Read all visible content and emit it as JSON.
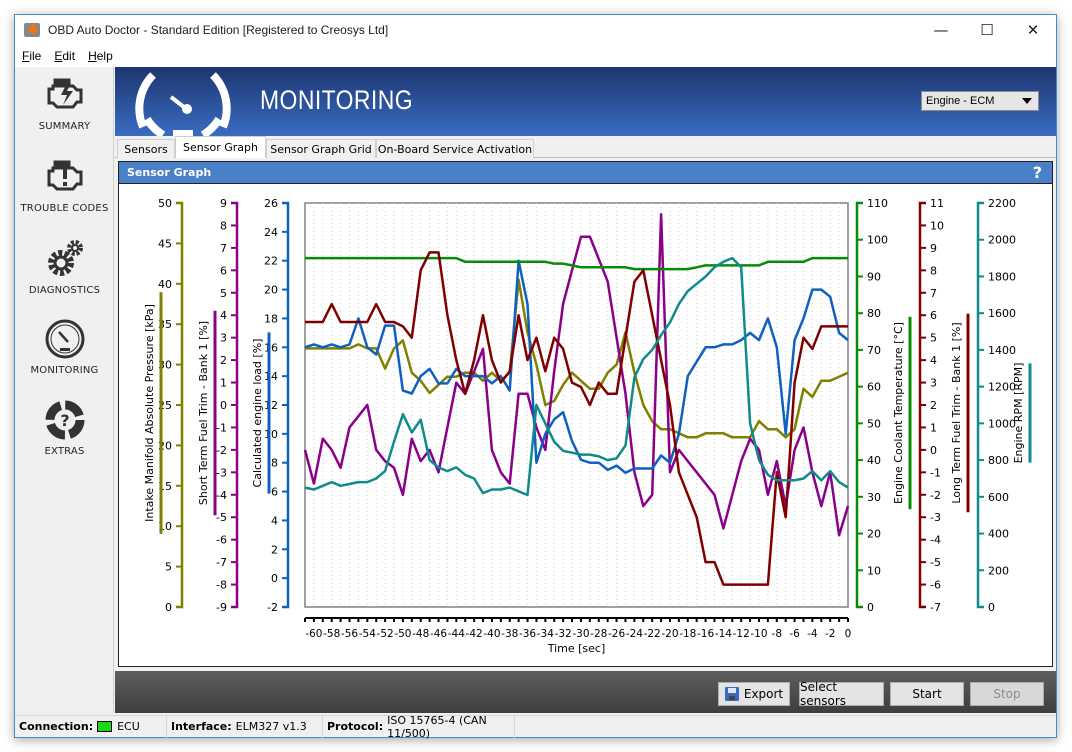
{
  "window": {
    "title": "OBD Auto Doctor - Standard Edition [Registered to Creosys Ltd]",
    "icon": "app-logo-icon",
    "controls": [
      "minimize",
      "maximize",
      "close"
    ],
    "control_glyphs": [
      "—",
      "☐",
      "✕"
    ]
  },
  "menu": [
    {
      "label": "File",
      "accel": "F",
      "rest": "ile"
    },
    {
      "label": "Edit",
      "accel": "E",
      "rest": "dit"
    },
    {
      "label": "Help",
      "accel": "H",
      "rest": "elp"
    }
  ],
  "sidebar": {
    "items": [
      {
        "label": "SUMMARY",
        "icon": "engine-check-icon"
      },
      {
        "label": "TROUBLE CODES",
        "icon": "engine-warning-icon"
      },
      {
        "label": "DIAGNOSTICS",
        "icon": "gears-icon"
      },
      {
        "label": "MONITORING",
        "icon": "gauge-icon",
        "active": true
      },
      {
        "label": "EXTRAS",
        "icon": "lifebuoy-help-icon"
      }
    ]
  },
  "header": {
    "title": "MONITORING",
    "ecu_select": {
      "value": "Engine - ECM"
    }
  },
  "tabs": [
    {
      "label": "Sensors",
      "active": false
    },
    {
      "label": "Sensor Graph",
      "active": true
    },
    {
      "label": "Sensor Graph Grid",
      "active": false
    },
    {
      "label": "On-Board Service Activation",
      "active": false
    }
  ],
  "panel": {
    "title": "Sensor Graph",
    "help": "?"
  },
  "buttons": {
    "export": "Export",
    "select_sensors": "Select sensors",
    "start": "Start",
    "stop": "Stop"
  },
  "status": {
    "connection_label": "Connection:",
    "connection_value": "ECU",
    "connection_color": "#18d818",
    "interface_label": "Interface:",
    "interface_value": "ELM327 v1.3",
    "protocol_label": "Protocol:",
    "protocol_value": "ISO 15765-4 (CAN 11/500)"
  },
  "chart_data": {
    "type": "line",
    "title": "Sensor Graph",
    "xlabel": "Time [sec]",
    "xlim": [
      -61,
      0
    ],
    "x_ticks": [
      -60,
      -58,
      -56,
      -54,
      -52,
      -50,
      -48,
      -46,
      -44,
      -42,
      -40,
      -38,
      -36,
      -34,
      -32,
      -30,
      -28,
      -26,
      -24,
      -22,
      -20,
      -18,
      -16,
      -14,
      -12,
      -10,
      -8,
      -6,
      -4,
      -2,
      0
    ],
    "grid": "vertical-dotted",
    "x": [
      -61,
      -60,
      -59,
      -58,
      -57,
      -56,
      -55,
      -54,
      -53,
      -52,
      -51,
      -50,
      -49,
      -48,
      -47,
      -46,
      -45,
      -44,
      -43,
      -42,
      -41,
      -40,
      -39,
      -38,
      -37,
      -36,
      -35,
      -34,
      -33,
      -32,
      -31,
      -30,
      -29,
      -28,
      -27,
      -26,
      -25,
      -24,
      -23,
      -22,
      -21,
      -20,
      -19,
      -18,
      -17,
      -16,
      -15,
      -14,
      -13,
      -12,
      -11,
      -10,
      -9,
      -8,
      -7,
      -6,
      -5,
      -4,
      -3,
      -2,
      -1,
      0
    ],
    "axes": [
      {
        "side": "left",
        "label": "Intake Manifold Absolute Pressure [kPa]",
        "color": "#808000",
        "range": [
          0,
          50
        ],
        "ticks": [
          0,
          5,
          10,
          15,
          20,
          25,
          30,
          35,
          40,
          45,
          50
        ]
      },
      {
        "side": "left",
        "label": "Short Term Fuel Trim - Bank 1 [%]",
        "color": "#8b008b",
        "range": [
          -9,
          9
        ],
        "ticks": [
          -9,
          -8,
          -7,
          -6,
          -5,
          -4,
          -3,
          -2,
          -1,
          0,
          1,
          2,
          3,
          4,
          5,
          6,
          7,
          8,
          9
        ]
      },
      {
        "side": "left",
        "label": "Calculated engine load [%]",
        "color": "#1060c0",
        "range": [
          -2,
          26
        ],
        "ticks": [
          -2,
          0,
          2,
          4,
          6,
          8,
          10,
          12,
          14,
          16,
          18,
          20,
          22,
          24,
          26
        ]
      },
      {
        "side": "right",
        "label": "Engine Coolant Temperature [°C]",
        "color": "#078c07",
        "range": [
          0,
          110
        ],
        "ticks": [
          0,
          10,
          20,
          30,
          40,
          50,
          60,
          70,
          80,
          90,
          100,
          110
        ]
      },
      {
        "side": "right",
        "label": "Long Term Fuel Trim - Bank 1 [%]",
        "color": "#800000",
        "range": [
          -7,
          11
        ],
        "ticks": [
          -7,
          -6,
          -5,
          -4,
          -3,
          -2,
          -1,
          0,
          1,
          2,
          3,
          4,
          5,
          6,
          7,
          8,
          9,
          10,
          11
        ]
      },
      {
        "side": "right",
        "label": "Engine RPM [RPM]",
        "color": "#108a8a",
        "range": [
          0,
          2200
        ],
        "ticks": [
          0,
          200,
          400,
          600,
          800,
          1000,
          1200,
          1400,
          1600,
          1800,
          2000,
          2200
        ]
      }
    ],
    "series": [
      {
        "name": "Intake Manifold Absolute Pressure",
        "axis": 0,
        "color": "#808000",
        "values": [
          32,
          32,
          32,
          32,
          32,
          32,
          32.5,
          32,
          32,
          29.5,
          32,
          33,
          29,
          28,
          26.5,
          27.5,
          28.5,
          28.5,
          29,
          29,
          28,
          29,
          28,
          29,
          40.5,
          34,
          30,
          25,
          25.5,
          27.5,
          29,
          28,
          27,
          27,
          29,
          30,
          34,
          29,
          25,
          23,
          22,
          22,
          21.5,
          21,
          21,
          21.5,
          21.5,
          21.5,
          21,
          21,
          21,
          23,
          22,
          22,
          21,
          22,
          27,
          26,
          28,
          28,
          28.5,
          29
        ]
      },
      {
        "name": "Short Term Fuel Trim - Bank 1",
        "axis": 1,
        "color": "#8b008b",
        "values": [
          -2,
          -3.5,
          -1.5,
          -2,
          -2.8,
          -1,
          -0.5,
          0,
          -2,
          -2.5,
          -2.8,
          -4,
          -1.5,
          -2.5,
          -2,
          -3,
          -1,
          1,
          0.5,
          1.5,
          2.5,
          -2,
          -3,
          -3.5,
          0.5,
          0.5,
          -1,
          -2,
          1.5,
          4.5,
          6,
          7.5,
          7.5,
          6.5,
          5.5,
          3,
          0.5,
          -3,
          -4.5,
          -4,
          8.5,
          -3,
          -2,
          -2.5,
          -3,
          -3.5,
          -4,
          -5.5,
          -4,
          -2.5,
          -1.5,
          -2,
          -4,
          -2.5,
          -4.5,
          -2,
          -1,
          -3,
          -4.5,
          -3,
          -5.8,
          -4.5
        ]
      },
      {
        "name": "Calculated engine load",
        "axis": 2,
        "color": "#1060c0",
        "values": [
          16,
          16.2,
          16,
          16.2,
          16,
          16.2,
          18,
          16,
          15.5,
          17.5,
          17.5,
          13,
          12.8,
          14,
          14.5,
          13.5,
          13.5,
          14.5,
          14,
          14,
          14,
          13.5,
          14,
          13,
          22,
          19,
          8,
          10,
          11,
          11.5,
          9.5,
          8.2,
          8,
          8,
          7.5,
          7.8,
          7.3,
          7.6,
          7.6,
          7.6,
          8.5,
          8,
          10,
          14,
          15,
          16,
          16,
          16.2,
          16.2,
          16.5,
          17,
          16.5,
          18,
          16,
          10,
          16.5,
          18,
          20,
          20,
          19.5,
          17,
          16.5
        ]
      },
      {
        "name": "Engine Coolant Temperature",
        "axis": 3,
        "color": "#078c07",
        "values": [
          95,
          95,
          95,
          95,
          95,
          95,
          95,
          95,
          95,
          95,
          95,
          95,
          95,
          95,
          95,
          95,
          95,
          95,
          94,
          94,
          94,
          94,
          94,
          94,
          94,
          94,
          94,
          94,
          93.5,
          93.5,
          93,
          92.5,
          92.5,
          92.5,
          92.5,
          92.5,
          92.5,
          92,
          92,
          92,
          92,
          92,
          92,
          92,
          92.5,
          93,
          93,
          93,
          93,
          93,
          93,
          93,
          94,
          94,
          94,
          94,
          94,
          95,
          95,
          95,
          95,
          95
        ]
      },
      {
        "name": "Long Term Fuel Trim - Bank 1",
        "axis": 4,
        "color": "#800000",
        "values": [
          5.7,
          5.7,
          5.7,
          6.5,
          5.7,
          5.7,
          5.7,
          5.7,
          6.5,
          5.7,
          5.7,
          5.5,
          5,
          8,
          8.8,
          8.8,
          6,
          4,
          2.5,
          4,
          6,
          4,
          3,
          3.5,
          6,
          4,
          5,
          3.5,
          5,
          4.5,
          3,
          2.8,
          2,
          3,
          2.5,
          2.5,
          5,
          7.5,
          8,
          6,
          4,
          2,
          -1,
          -2,
          -3,
          -5,
          -5,
          -6,
          -6,
          -6,
          -6,
          -6,
          -6,
          -1,
          -3,
          3,
          5,
          4.5,
          5.5,
          5.5,
          5.5,
          5.5
        ]
      },
      {
        "name": "Engine RPM",
        "axis": 5,
        "color": "#108a8a",
        "values": [
          650,
          640,
          660,
          680,
          660,
          670,
          680,
          680,
          700,
          740,
          900,
          1050,
          950,
          1020,
          800,
          760,
          740,
          760,
          720,
          700,
          620,
          640,
          640,
          650,
          630,
          610,
          1100,
          1000,
          900,
          850,
          840,
          830,
          830,
          820,
          800,
          810,
          880,
          1250,
          1350,
          1400,
          1480,
          1550,
          1650,
          1720,
          1760,
          1800,
          1850,
          1880,
          1900,
          1850,
          1000,
          800,
          720,
          690,
          690,
          690,
          700,
          740,
          690,
          740,
          680,
          650
        ]
      }
    ]
  }
}
